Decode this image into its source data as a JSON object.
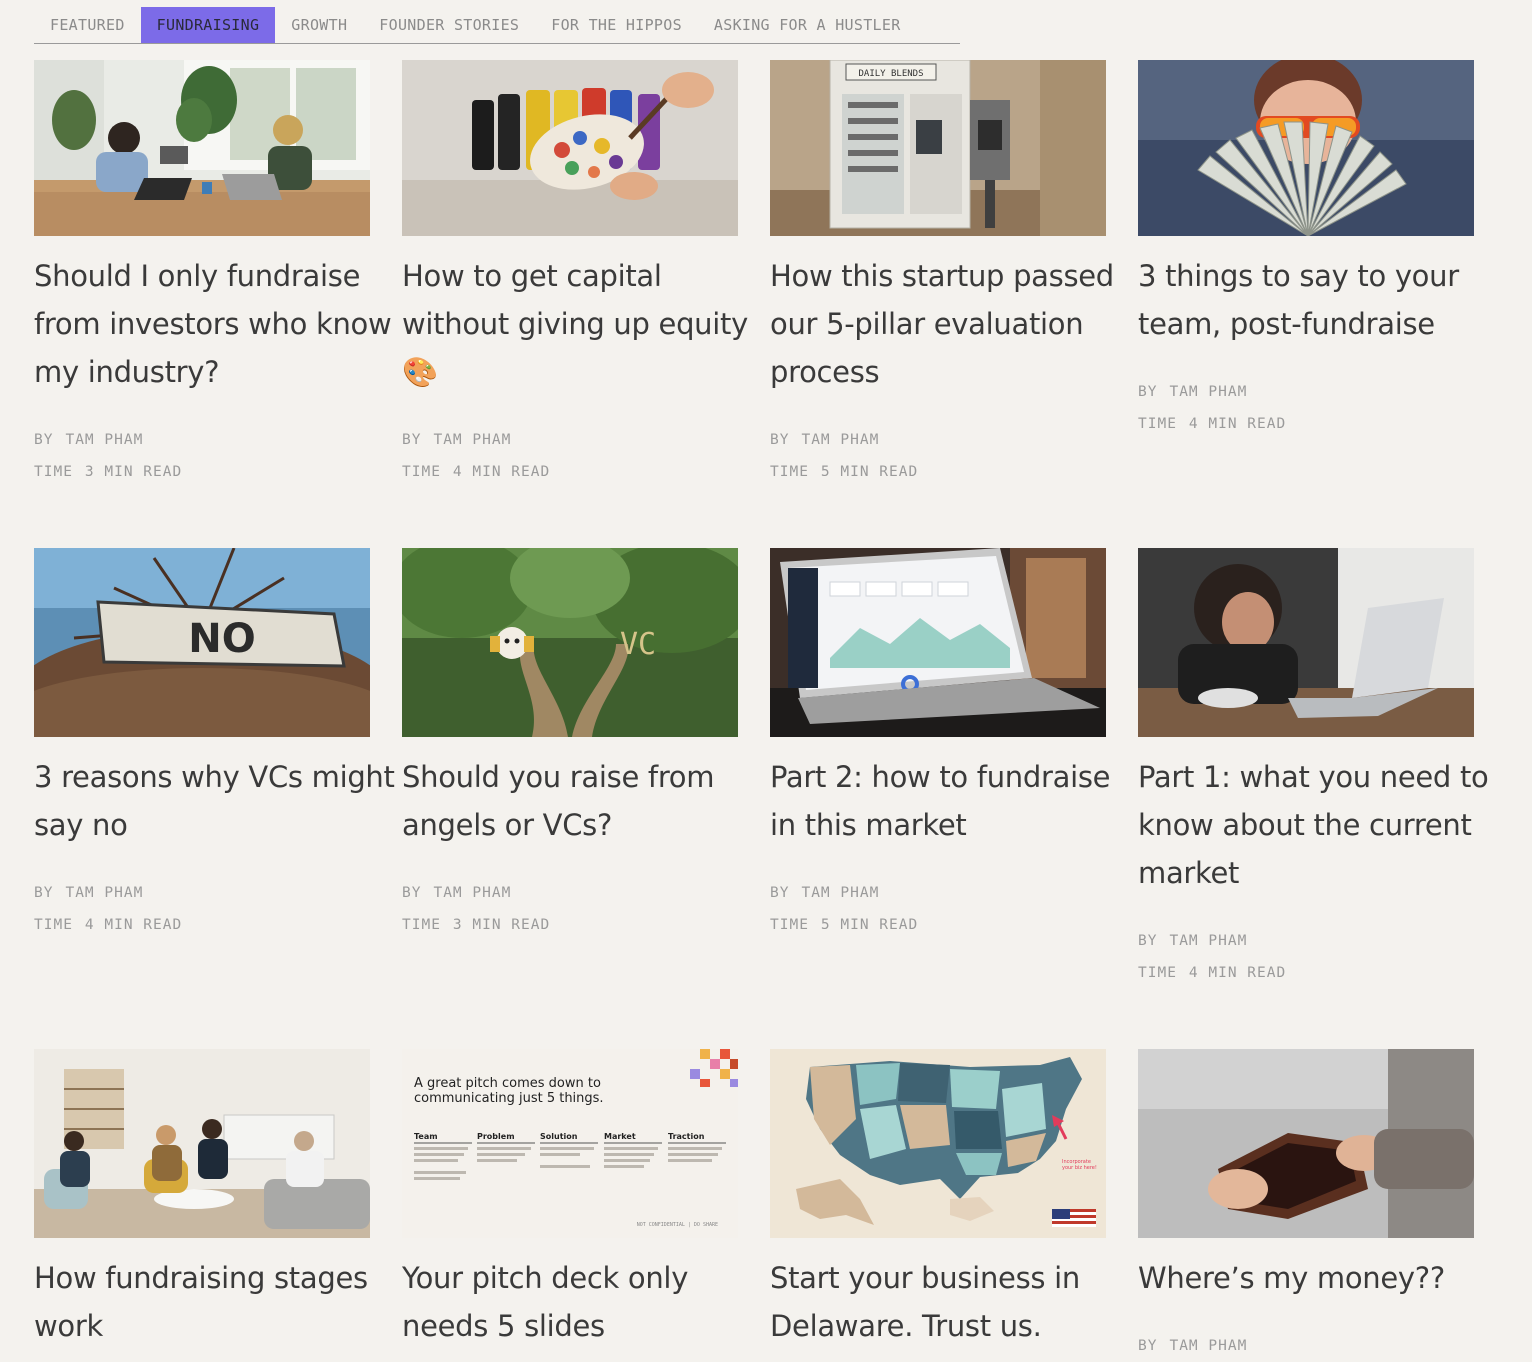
{
  "tabs": [
    {
      "label": "FEATURED",
      "active": false
    },
    {
      "label": "FUNDRAISING",
      "active": true
    },
    {
      "label": "GROWTH",
      "active": false
    },
    {
      "label": "FOUNDER STORIES",
      "active": false
    },
    {
      "label": "FOR THE HIPPOS",
      "active": false
    },
    {
      "label": "ASKING FOR A HUSTLER",
      "active": false
    }
  ],
  "meta_labels": {
    "by": "BY",
    "time": "TIME"
  },
  "articles": [
    {
      "title": "Should I only fundraise from investors who know my industry?",
      "author": "TAM PHAM",
      "read_time": "3 MIN READ",
      "image": "two-women-meeting-laptops"
    },
    {
      "title": "How to get capital without giving up equity 🎨",
      "author": "TAM PHAM",
      "read_time": "4 MIN READ",
      "image": "paint-palette"
    },
    {
      "title": "How this startup passed our 5-pillar evaluation process",
      "author": "TAM PHAM",
      "read_time": "5 MIN READ",
      "image": "daily-blends-vending-machine"
    },
    {
      "title": "3 things to say to your team, post-fundraise",
      "author": "TAM PHAM",
      "read_time": "4 MIN READ",
      "image": "man-with-cash-fan"
    },
    {
      "title": "3 reasons why VCs might say no",
      "author": "TAM PHAM",
      "read_time": "4 MIN READ",
      "image": "no-sign-on-tree"
    },
    {
      "title": "Should you raise from angels or VCs?",
      "author": "TAM PHAM",
      "read_time": "3 MIN READ",
      "image": "forest-path-fork"
    },
    {
      "title": "Part 2: how to fundraise in this market",
      "author": "TAM PHAM",
      "read_time": "5 MIN READ",
      "image": "laptop-dashboard"
    },
    {
      "title": "Part 1: what you need to know about the current market",
      "author": "TAM PHAM",
      "read_time": "4 MIN READ",
      "image": "stressed-woman-laptop"
    },
    {
      "title": "How fundraising stages work",
      "author": "",
      "read_time": "",
      "image": "living-room-meeting"
    },
    {
      "title": "Your pitch deck only needs 5 slides",
      "author": "",
      "read_time": "",
      "image": "pitch-slide"
    },
    {
      "title": "Start your business in Delaware. Trust us.",
      "author": "",
      "read_time": "",
      "image": "us-map"
    },
    {
      "title": "Where’s my money??",
      "author": "TAM PHAM",
      "read_time": "",
      "image": "empty-wallet"
    }
  ],
  "art": {
    "vending_sign": "DAILY BLENDS",
    "no_sign": "NO",
    "forest_label": "VC",
    "pitch": {
      "heading_line1": "A great pitch comes down to",
      "heading_line2": "communicating just 5 things.",
      "columns": [
        "Team",
        "Problem",
        "Solution",
        "Market",
        "Traction"
      ],
      "footer": "NOT CONFIDENTIAL | DO SHARE"
    },
    "map_note_line1": "Incorporate",
    "map_note_line2": "your biz here!"
  },
  "colors": {
    "accent": "#7c6be8",
    "background": "#f4f2ee"
  }
}
